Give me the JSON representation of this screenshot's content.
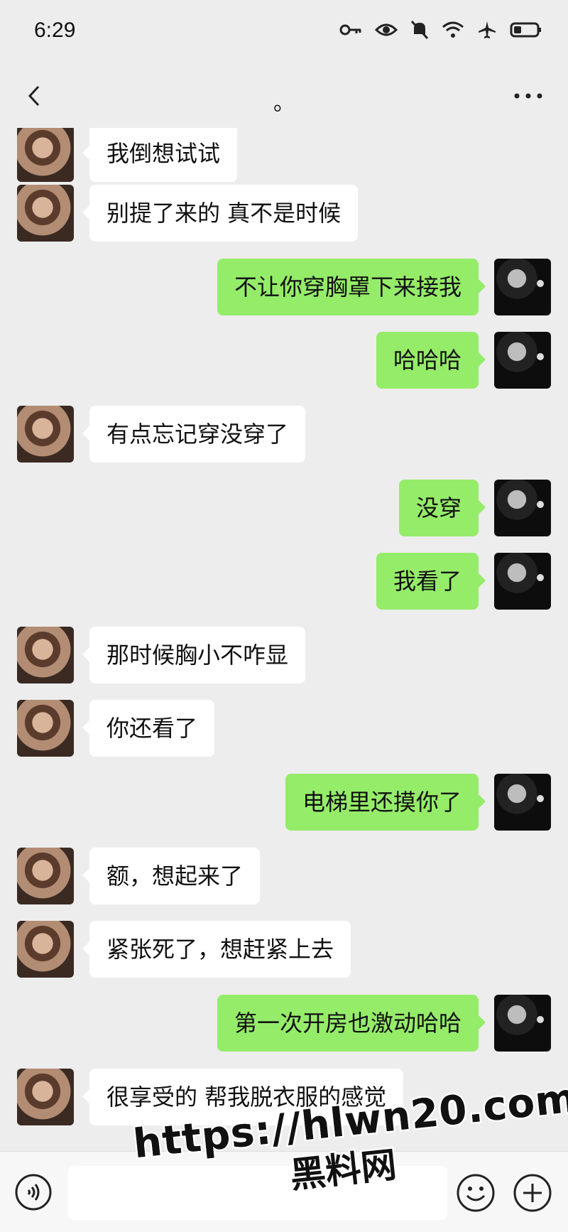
{
  "status_bar": {
    "time": "6:29",
    "icons": [
      "key-icon",
      "eye-icon",
      "mute-bell-icon",
      "wifi-icon",
      "airplane-icon",
      "battery-icon"
    ]
  },
  "nav": {
    "title": "。",
    "back_icon": "chevron-left-icon",
    "more_icon": "more-icon"
  },
  "colors": {
    "chat_bg": "#ededed",
    "incoming_bubble": "#ffffff",
    "outgoing_bubble": "#95ec69"
  },
  "messages": [
    {
      "side": "left",
      "text": "我倒想试试"
    },
    {
      "side": "left",
      "text": "别提了来的 真不是时候"
    },
    {
      "side": "right",
      "text": "不让你穿胸罩下来接我"
    },
    {
      "side": "right",
      "text": "哈哈哈"
    },
    {
      "side": "left",
      "text": "有点忘记穿没穿了"
    },
    {
      "side": "right",
      "text": "没穿"
    },
    {
      "side": "right",
      "text": "我看了"
    },
    {
      "side": "left",
      "text": "那时候胸小不咋显"
    },
    {
      "side": "left",
      "text": "你还看了"
    },
    {
      "side": "right",
      "text": "电梯里还摸你了"
    },
    {
      "side": "left",
      "text": "额，想起来了"
    },
    {
      "side": "left",
      "text": "紧张死了，想赶紧上去"
    },
    {
      "side": "right",
      "text": "第一次开房也激动哈哈"
    },
    {
      "side": "left",
      "text": "很享受的  帮我脱衣服的感觉"
    }
  ],
  "input_bar": {
    "voice_icon": "voice-icon",
    "emoji_icon": "emoji-icon",
    "plus_icon": "plus-icon",
    "input_value": ""
  },
  "watermark": {
    "line1": "https://hlwn20.com",
    "line2": "黑料网"
  }
}
